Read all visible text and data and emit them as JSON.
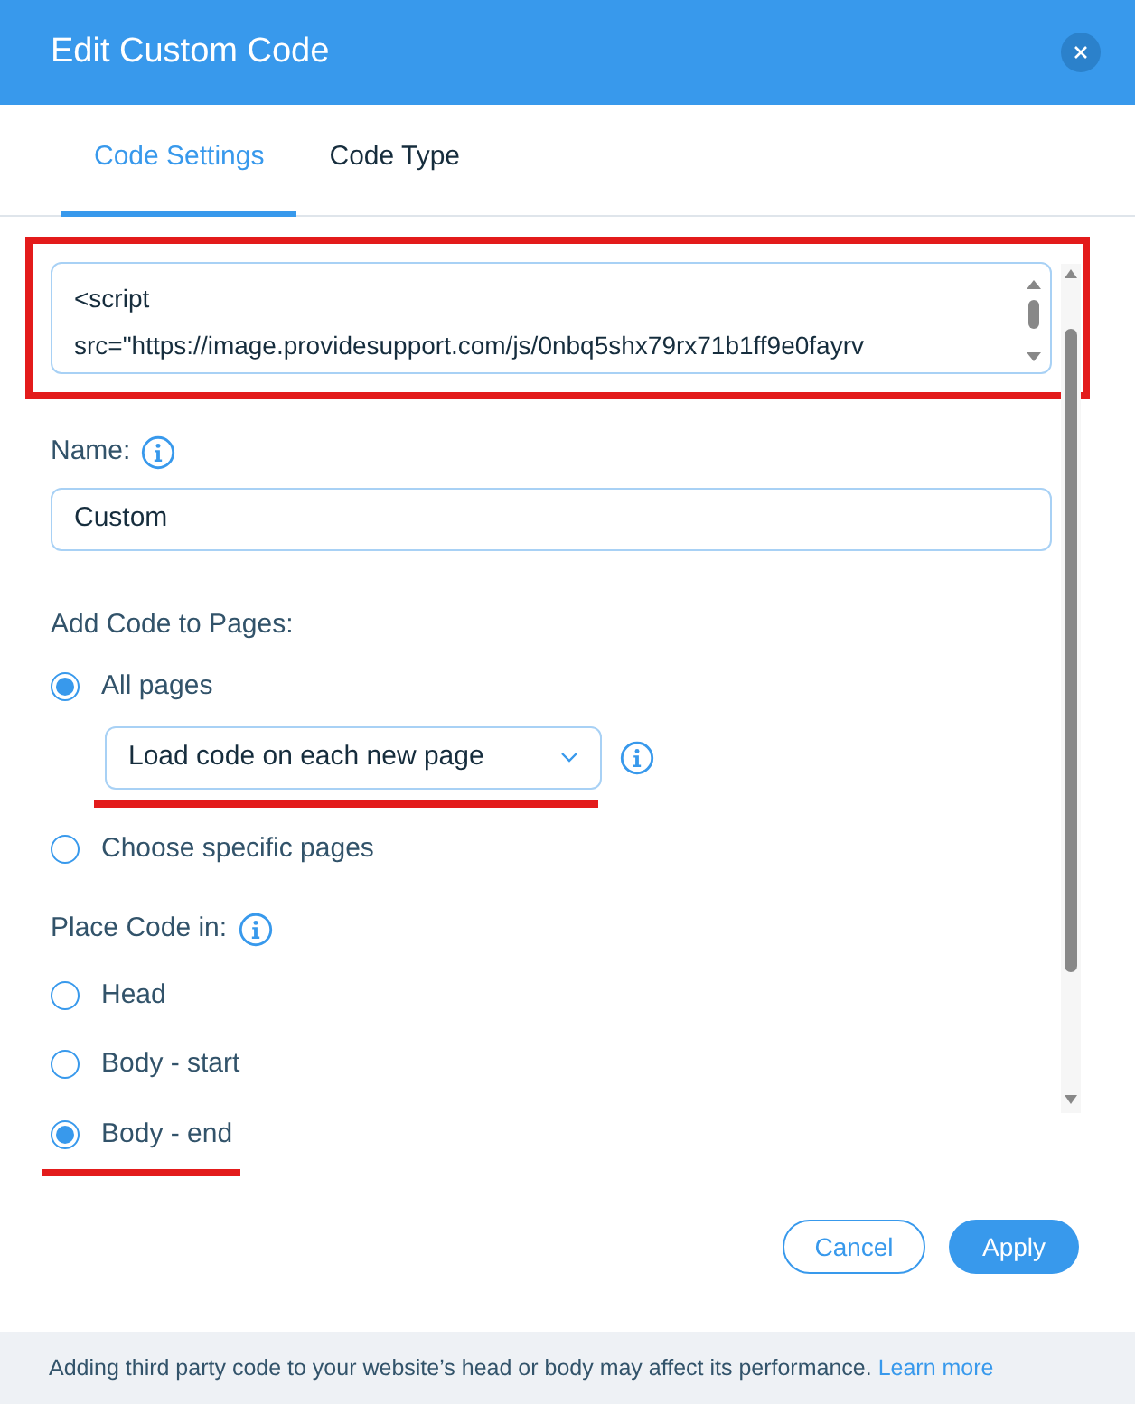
{
  "dialog": {
    "title": "Edit Custom Code"
  },
  "tabs": [
    {
      "label": "Code Settings",
      "selected": true
    },
    {
      "label": "Code Type",
      "selected": false
    }
  ],
  "code": {
    "value": "<script\nsrc=\"https://image.providesupport.com/js/0nbq5shx79rx71b1ff9e0fayrv"
  },
  "name_field": {
    "label": "Name:",
    "value": "Custom"
  },
  "pages": {
    "label": "Add Code to Pages:",
    "options": [
      {
        "label": "All pages",
        "selected": true,
        "dropdown": "Load code on each new page"
      },
      {
        "label": "Choose specific pages",
        "selected": false
      }
    ]
  },
  "placement": {
    "label": "Place Code in:",
    "options": [
      {
        "label": "Head",
        "selected": false
      },
      {
        "label": "Body - start",
        "selected": false
      },
      {
        "label": "Body - end",
        "selected": true
      }
    ]
  },
  "buttons": {
    "cancel": "Cancel",
    "apply": "Apply"
  },
  "footer": {
    "text": "Adding third party code to your website’s head or body may affect its performance.",
    "link": "Learn more"
  }
}
